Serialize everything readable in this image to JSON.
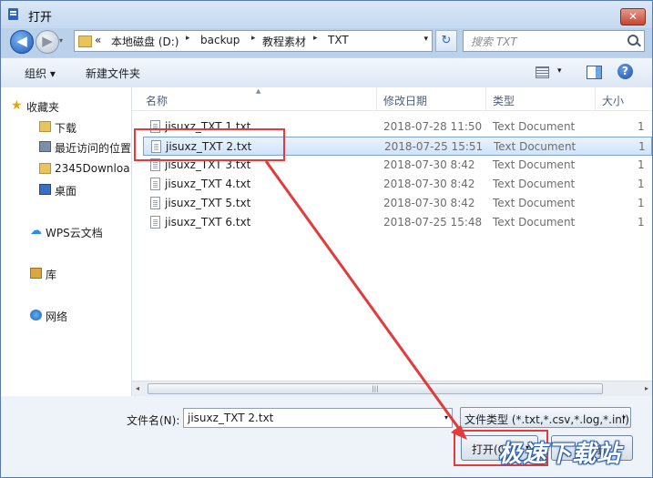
{
  "window": {
    "title": "打开",
    "close_glyph": "✕"
  },
  "nav": {
    "back_glyph": "◀",
    "forward_glyph": "▶",
    "history_glyph": "▾",
    "address": {
      "overflow": "«",
      "crumbs": [
        "本地磁盘 (D:)",
        "backup",
        "教程素材",
        "TXT"
      ],
      "separator": "▸",
      "dropdown_glyph": "▾"
    },
    "refresh_glyph": "↻",
    "search": {
      "placeholder": "搜索 TXT"
    }
  },
  "toolbar": {
    "organize_label": "组织 ▾",
    "new_folder_label": "新建文件夹",
    "view_dropdown_glyph": "▾",
    "help_glyph": "?"
  },
  "sidebar": {
    "favorites": {
      "label": "收藏夹",
      "icon": "star-icon"
    },
    "favorite_items": [
      {
        "label": "下载",
        "icon": "folder-icon"
      },
      {
        "label": "最近访问的位置",
        "icon": "recent-places-icon"
      },
      {
        "label": "2345Downloa",
        "icon": "folder-icon"
      },
      {
        "label": "桌面",
        "icon": "desktop-icon"
      }
    ],
    "wps": {
      "label": "WPS云文档",
      "icon": "cloud-icon"
    },
    "libraries": {
      "label": "库",
      "icon": "library-icon"
    },
    "network": {
      "label": "网络",
      "icon": "network-icon"
    }
  },
  "file_list": {
    "columns": [
      "名称",
      "修改日期",
      "类型",
      "大小"
    ],
    "sort_glyph": "▲",
    "rows": [
      {
        "name": "jisuxz_TXT 1.txt",
        "date": "2018-07-28 11:50",
        "type": "Text Document",
        "size": "1",
        "selected": false
      },
      {
        "name": "jisuxz_TXT 2.txt",
        "date": "2018-07-25 15:51",
        "type": "Text Document",
        "size": "1",
        "selected": true
      },
      {
        "name": "jisuxz_TXT 3.txt",
        "date": "2018-07-30 8:42",
        "type": "Text Document",
        "size": "1",
        "selected": false
      },
      {
        "name": "jisuxz_TXT 4.txt",
        "date": "2018-07-30 8:42",
        "type": "Text Document",
        "size": "1",
        "selected": false
      },
      {
        "name": "jisuxz_TXT 5.txt",
        "date": "2018-07-30 8:42",
        "type": "Text Document",
        "size": "1",
        "selected": false
      },
      {
        "name": "jisuxz_TXT 6.txt",
        "date": "2018-07-25 15:48",
        "type": "Text Document",
        "size": "1",
        "selected": false
      }
    ]
  },
  "scrollbar": {
    "left_glyph": "◂",
    "right_glyph": "▸",
    "grip": "|||"
  },
  "bottom": {
    "filename_label": "文件名(N):",
    "filename_value": "jisuxz_TXT 2.txt",
    "filename_drop_glyph": "▾",
    "filetype_value": "文件类型 (*.txt,*.csv,*.log,*.ini)",
    "filetype_drop_glyph": "▾",
    "open_label": "打开(O)",
    "open_drop_glyph": "▾",
    "cancel_label": "取消"
  },
  "annotation": {
    "color": "#e23b3b"
  },
  "watermark": {
    "text": "极速下载站"
  }
}
